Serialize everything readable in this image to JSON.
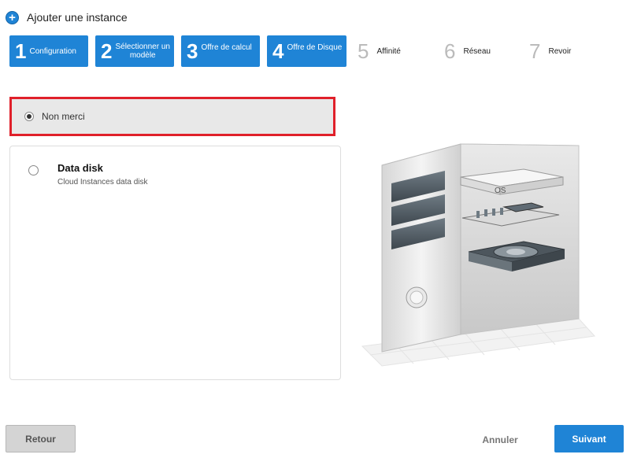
{
  "header": {
    "title": "Ajouter une instance",
    "icon": "add-circle-icon"
  },
  "steps": [
    {
      "num": "1",
      "label": "Configuration",
      "label2": ""
    },
    {
      "num": "2",
      "label": "Sélectionner un",
      "label2": "modèle"
    },
    {
      "num": "3",
      "label": "Offre de calcul",
      "label2": ""
    },
    {
      "num": "4",
      "label": "Offre de Disque",
      "label2": ""
    },
    {
      "num": "5",
      "label": "Affinité",
      "label2": ""
    },
    {
      "num": "6",
      "label": "Réseau",
      "label2": ""
    },
    {
      "num": "7",
      "label": "Revoir",
      "label2": ""
    }
  ],
  "options": {
    "none_label": "Non merci",
    "disk_name": "Data disk",
    "disk_desc": "Cloud Instances data disk"
  },
  "illustration": {
    "os_label": "OS"
  },
  "buttons": {
    "back": "Retour",
    "cancel": "Annuler",
    "next": "Suivant"
  },
  "colors": {
    "accent": "#1f84d6",
    "highlight": "#e0202a"
  }
}
